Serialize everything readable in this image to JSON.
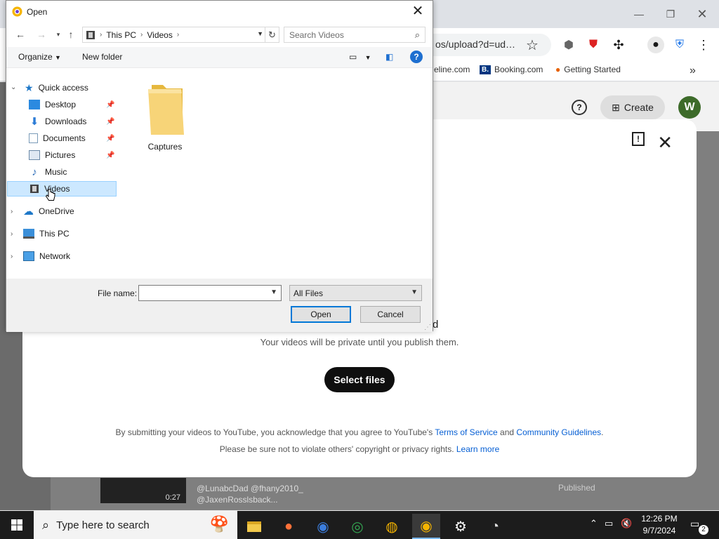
{
  "browser": {
    "url_fragment": "os/upload?d=ud…",
    "bookmarks": [
      "eline.com",
      "Booking.com",
      "Getting Started"
    ],
    "create_label": "Create",
    "avatar_letter": "W"
  },
  "upload_dialog": {
    "partial_heading": "d",
    "private_note": "Your videos will be private until you publish them.",
    "select_files_label": "Select files",
    "terms_prefix": "By submitting your videos to YouTube, you acknowledge that you agree to YouTube's ",
    "terms_link": "Terms of Service",
    "terms_and": " and ",
    "guidelines_link": "Community Guidelines",
    "terms_end": ".",
    "copyright_text": "Please be sure not to violate others' copyright or privacy rights. ",
    "learn_more_link": "Learn more"
  },
  "behind_content": {
    "comment_line1": "@LunabcDad @fhany2010_",
    "comment_line2": "@JaxenRosslsback...",
    "duration": "0:27",
    "status": "Published"
  },
  "open_dialog": {
    "title": "Open",
    "breadcrumb": [
      "This PC",
      "Videos"
    ],
    "search_placeholder": "Search Videos",
    "organize_label": "Organize",
    "new_folder_label": "New folder",
    "nav_items": [
      {
        "label": "Quick access"
      },
      {
        "label": "Desktop"
      },
      {
        "label": "Downloads"
      },
      {
        "label": "Documents"
      },
      {
        "label": "Pictures"
      },
      {
        "label": "Music"
      },
      {
        "label": "Videos"
      },
      {
        "label": "OneDrive"
      },
      {
        "label": "This PC"
      },
      {
        "label": "Network"
      }
    ],
    "folders": [
      {
        "name": "Captures"
      }
    ],
    "file_name_label": "File name:",
    "file_name_value": "",
    "file_type": "All Files",
    "open_label": "Open",
    "cancel_label": "Cancel"
  },
  "taskbar": {
    "search_placeholder": "Type here to search",
    "time": "12:26 PM",
    "date": "9/7/2024",
    "notification_count": "2"
  },
  "colors": {
    "accent": "#0078d7",
    "selection": "#cce8ff",
    "youtube_link": "#065fd4",
    "folder": "#f2c94c"
  }
}
